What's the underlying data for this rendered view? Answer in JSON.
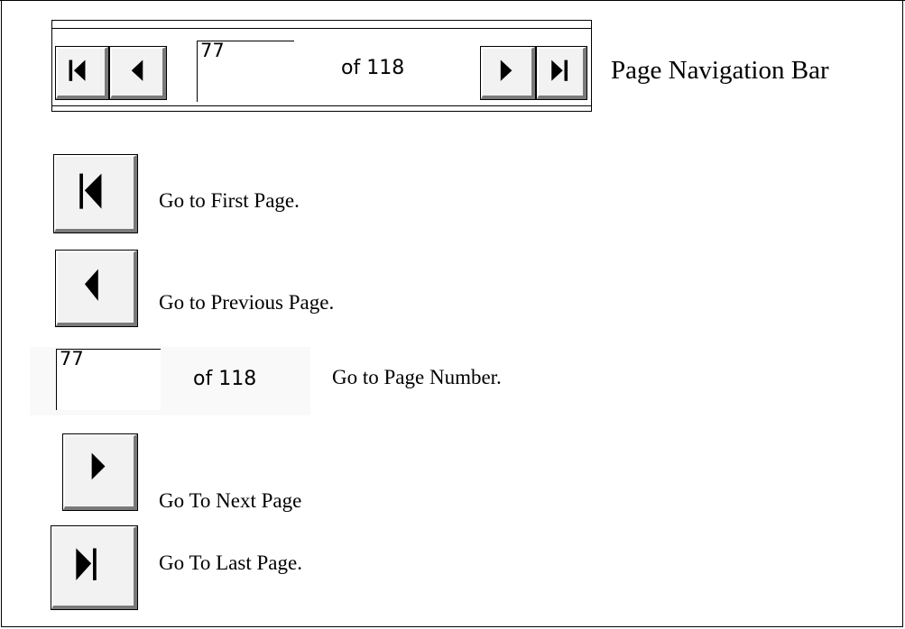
{
  "navbar": {
    "current_page": "77",
    "of_label": "of 118",
    "title": "Page Navigation Bar"
  },
  "legend": {
    "first": "Go to First Page.",
    "previous": "Go to Previous Page.",
    "goto_value": "77",
    "goto_of": "of 118",
    "goto": "Go to Page Number.",
    "next": "Go To Next Page",
    "last": "Go To Last Page."
  }
}
